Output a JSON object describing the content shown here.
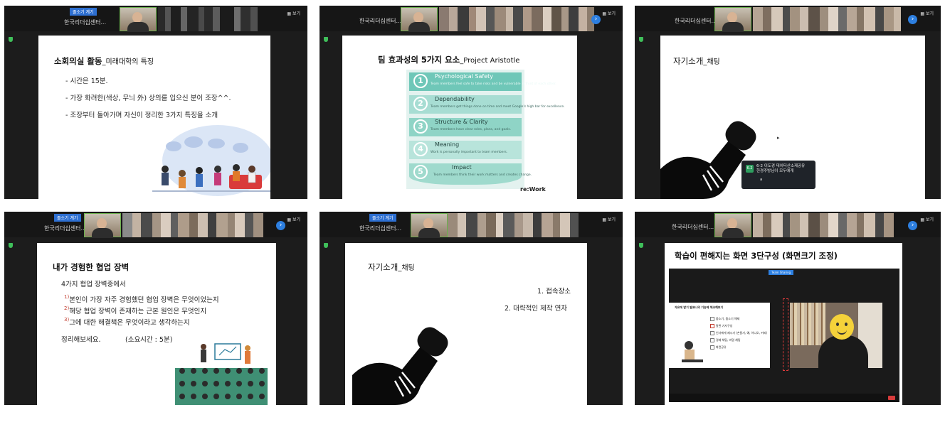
{
  "panels": [
    {
      "id": "p1",
      "meeting_name": "한국리더십센터...",
      "speaker_tag": "줄소기 계기",
      "view_label": "▦ 보기",
      "slide": {
        "title": "소회의실 활동",
        "title_suffix": "_미래대학의 특징",
        "bullets": [
          "- 시간은 15분.",
          "- 가장 화려한(색상, 무늬 外) 상의를 입으신 분이 조장^^.",
          "- 조장부터 돌아가며 자신이 정리한 3가지 특징을 소개"
        ]
      }
    },
    {
      "id": "p2",
      "meeting_name": "한국리더십센터...",
      "view_label": "▦ 보기",
      "slide": {
        "title": "팀 효과성의 5가지 요소",
        "title_suffix": "_Project Aristotle",
        "items": [
          {
            "num": "1",
            "title": "Psychological Safety",
            "desc": "Team members feel safe to take risks and be vulnerable in front of each other."
          },
          {
            "num": "2",
            "title": "Dependability",
            "desc": "Team members get things done on time and meet Google's high bar for excellence."
          },
          {
            "num": "3",
            "title": "Structure & Clarity",
            "desc": "Team members have clear roles, plans, and goals."
          },
          {
            "num": "4",
            "title": "Meaning",
            "desc": "Work is personally important to team members."
          },
          {
            "num": "5",
            "title": "Impact",
            "desc": "Team members think their work matters and creates change."
          }
        ],
        "logo": "re:Work"
      }
    },
    {
      "id": "p3",
      "meeting_name": "한국리더십센터...",
      "view_label": "▦ 보기",
      "slide": {
        "title": "자기소개",
        "title_suffix": "_채팅",
        "cursor": "▸"
      },
      "chat": {
        "avatar": "6.2",
        "line1": "6-2 이도경 데이터산소제공유",
        "line2": "한경주방님이 모두에게",
        "line3": "a"
      }
    },
    {
      "id": "p4",
      "meeting_name": "한국리더십센터...",
      "speaker_tag": "줄소기 계기",
      "view_label": "▦ 보기",
      "slide": {
        "title": "내가 경험한 협업 장벽",
        "intro": "4가지 협업 장벽중에서",
        "items": [
          {
            "mark": "1)",
            "text": "본인이 가장 자주 경험했던 협업 장벽은 무엇이었는지"
          },
          {
            "mark": "2)",
            "text": "해당 협업 장벽이 존재하는 근본 원인은 무엇인지"
          },
          {
            "mark": "3)",
            "text": "그에 대한 해결책은 무엇이라고 생각하는지"
          }
        ],
        "closing": "정리해보세요.",
        "time_note": "(소요시간 : 5분)"
      }
    },
    {
      "id": "p5",
      "meeting_name": "한국리더십센터...",
      "speaker_tag": "줄소기 계기",
      "view_label": "▦ 보기",
      "slide": {
        "title": "자기소개",
        "title_suffix": "_채팅",
        "items": [
          "1. 접속장소",
          "2. 대략적인 제작 연차"
        ]
      }
    },
    {
      "id": "p6",
      "meeting_name": "한국리더십센터...",
      "view_label": "▦ 보기",
      "slide": {
        "title": "학습이 편해지는 화면 3단구성 (화면크기 조정)",
        "share_tag": "Team Sharing",
        "worksheet": {
          "title": "자유에 받기 발표나의 기능에 체크해보기",
          "items": [
            "줌소기, 줌소기 해제",
            "말관 기사구성",
            "인사에게 제시기 (손들기, 예, 아니오, 커피)",
            "경제 채팅, 비밀 채팅",
            "화면공유"
          ]
        }
      }
    }
  ],
  "colors": {
    "accent_blue": "#2d7fe0",
    "green_shield": "#3fbf5a",
    "teal": "#6fc7b8"
  }
}
